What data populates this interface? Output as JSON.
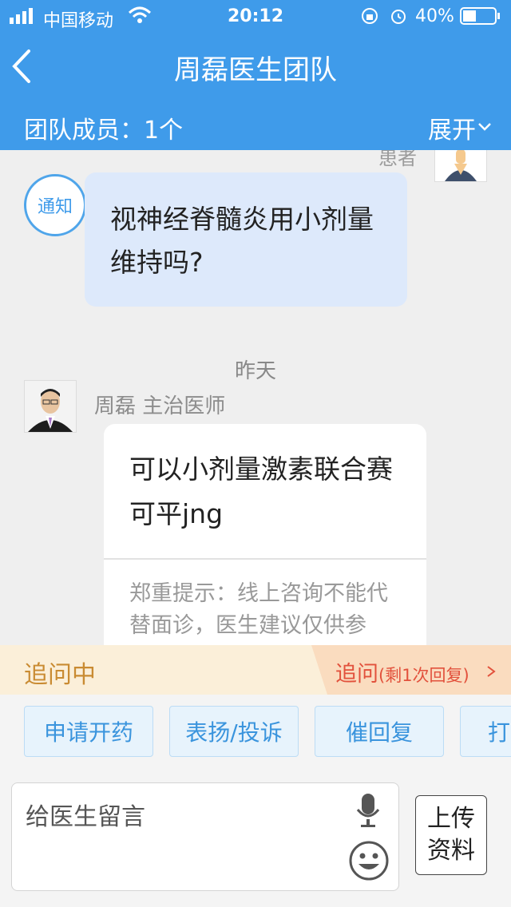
{
  "status": {
    "carrier": "中国移动",
    "time": "20:12",
    "battery": "40%"
  },
  "header": {
    "title": "周磊医生团队",
    "team_members": "团队成员：1个",
    "expand": "展开"
  },
  "chat": {
    "patient_label": "患者",
    "notice": "通知",
    "patient_message": "视神经脊髓炎用小剂量维持吗?",
    "date": "昨天",
    "doctor_name": "周磊 主治医师",
    "doctor_message": "可以小剂量激素联合赛可平jng",
    "hint": "郑重提示：线上咨询不能代替面诊，医生建议仅供参考！"
  },
  "inquiry": {
    "status": "追问中",
    "tag": "追问",
    "tag_small": "(剩1次回复)"
  },
  "actions": [
    "申请开药",
    "表扬/投诉",
    "催回复",
    "打"
  ],
  "input": {
    "placeholder": "给医生留言",
    "upload_line1": "上传",
    "upload_line2": "资料"
  }
}
